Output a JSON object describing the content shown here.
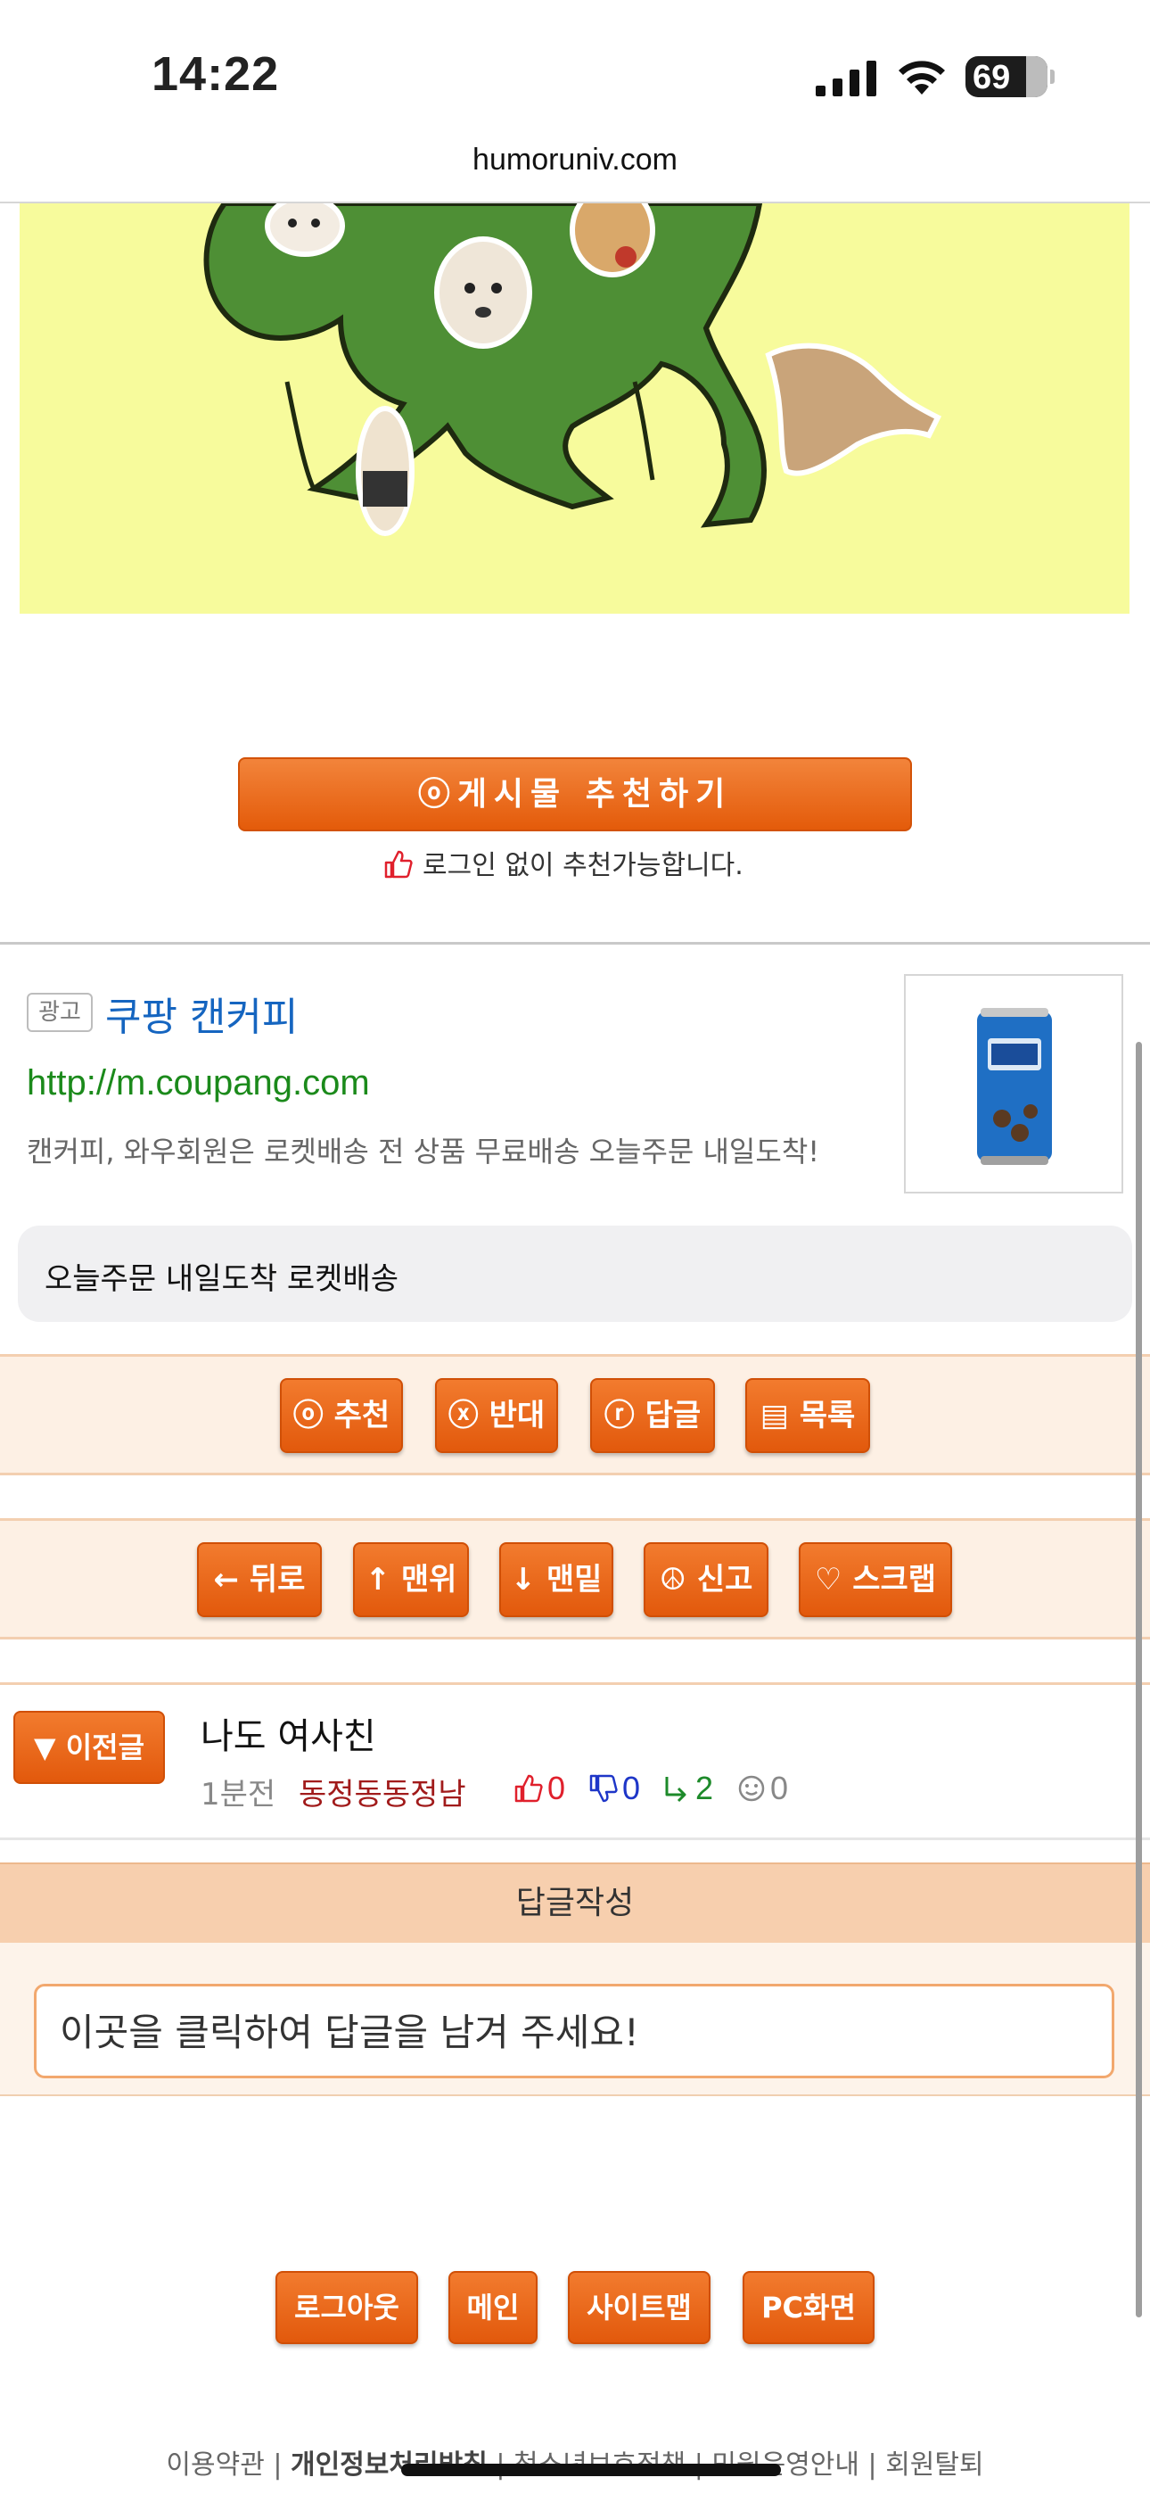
{
  "status_bar": {
    "time": "14:22",
    "battery": "69"
  },
  "browser": {
    "domain": "humoruniv.com"
  },
  "recommend": {
    "button_label": "ⓞ게시물  추천하기",
    "note": "로그인 없이 추천가능합니다."
  },
  "ad": {
    "badge": "광고",
    "title": "쿠팡 캔커피",
    "url": "http://m.coupang.com",
    "description": "캔커피, 와우회원은 로켓배송 전 상품 무료배송 오늘주문 내일도착!",
    "pill_text": "오늘주문 내일도착 로켓배송"
  },
  "actions_row1": [
    {
      "label": "ⓞ 추천"
    },
    {
      "label": "ⓧ 반대"
    },
    {
      "label": "ⓡ 답글"
    },
    {
      "label": "▤ 목록"
    }
  ],
  "actions_row2": [
    {
      "label": "← 뒤로"
    },
    {
      "label": "↑ 맨위"
    },
    {
      "label": "↓ 맨밑"
    },
    {
      "label": "☮ 신고"
    },
    {
      "label": "♡ 스크랩"
    }
  ],
  "prev_post": {
    "button_label": "▼ 이전글",
    "title": "나도 여사친",
    "time": "1분전",
    "author": "동정동동정남",
    "upvotes": "0",
    "downvotes": "0",
    "replies": "2",
    "views": "0"
  },
  "reply": {
    "header": "답글작성",
    "placeholder": "이곳을 클릭하여 답글을 남겨 주세요!"
  },
  "footer_buttons": [
    {
      "label": "로그아웃"
    },
    {
      "label": "메인"
    },
    {
      "label": "사이트맵"
    },
    {
      "label": "PC화면"
    }
  ],
  "footer_links": {
    "terms": "이용약관",
    "privacy": "개인정보처리방침",
    "youth": "청소년보호정책",
    "complaint": "민원운영안내",
    "withdraw": "회원탈퇴"
  },
  "colors": {
    "accent": "#e85e0e",
    "link_blue": "#1565c0",
    "url_green": "#1b8a1b",
    "author_red": "#a11b1b",
    "hero_bg": "#f7fb9c"
  }
}
